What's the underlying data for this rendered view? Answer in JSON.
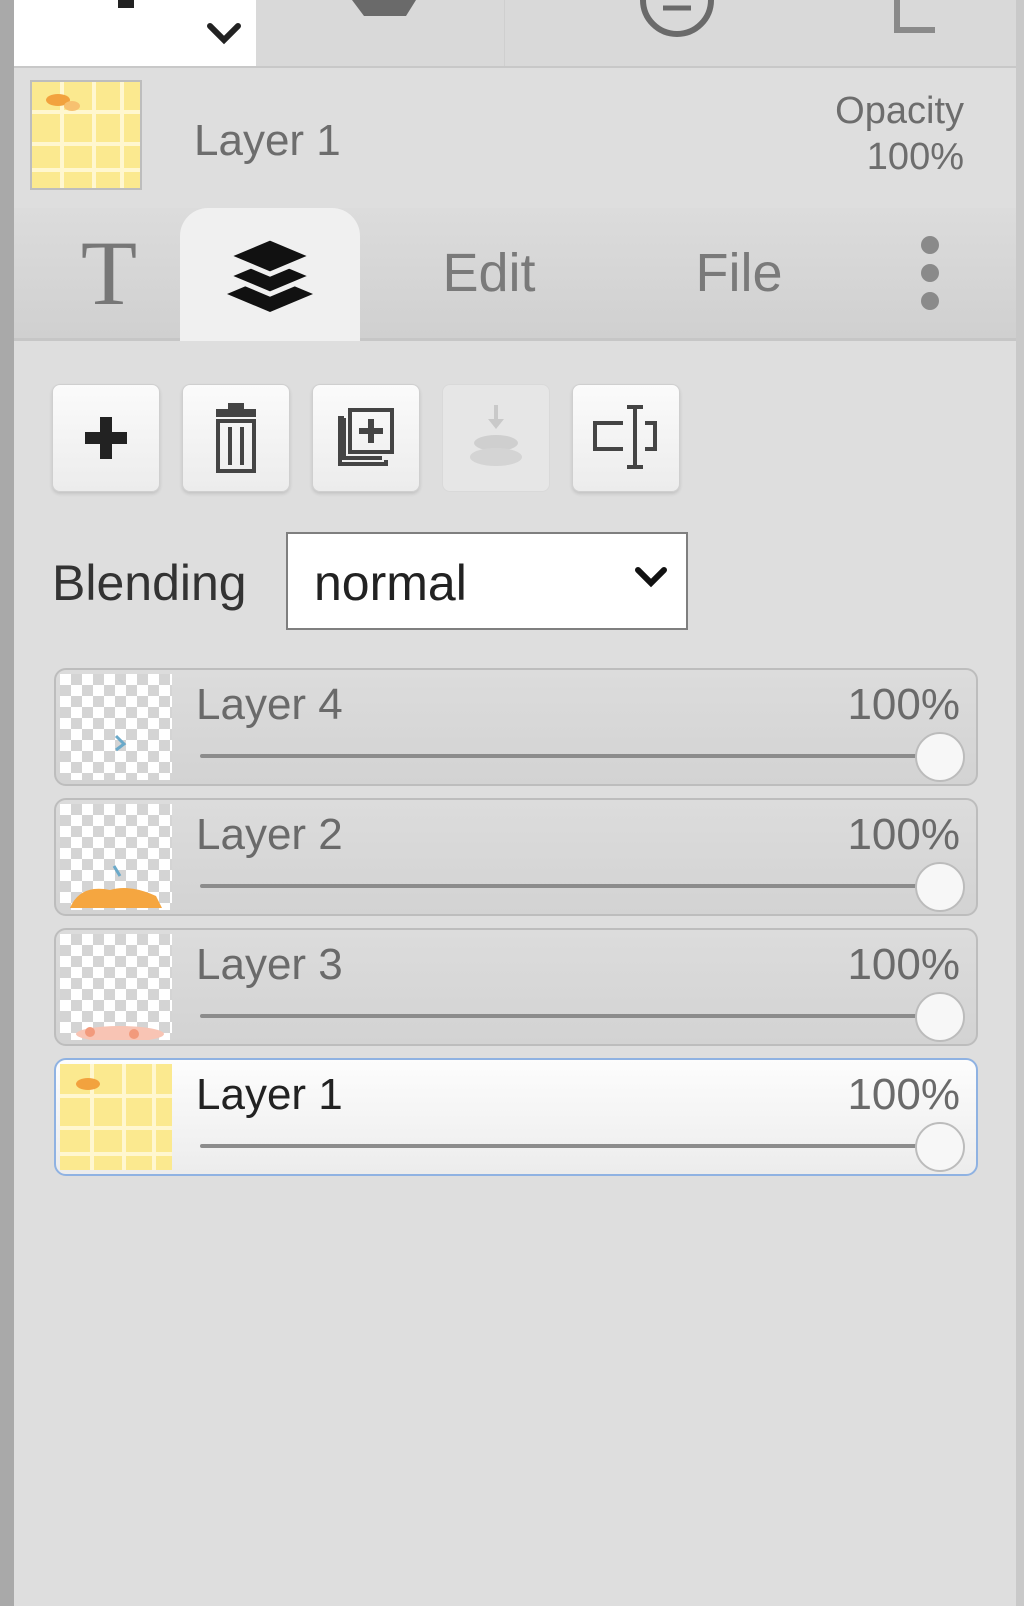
{
  "header": {
    "layer_name": "Layer 1",
    "opacity_label": "Opacity",
    "opacity_value": "100%"
  },
  "tabs": [
    {
      "id": "text",
      "label": "T",
      "icon": "text-icon"
    },
    {
      "id": "layers",
      "label": "",
      "icon": "layers-icon"
    },
    {
      "id": "edit",
      "label": "Edit"
    },
    {
      "id": "file",
      "label": "File"
    },
    {
      "id": "more",
      "label": "",
      "icon": "more-vertical-icon"
    }
  ],
  "actions": [
    {
      "name": "add-layer",
      "icon": "plus-icon"
    },
    {
      "name": "delete-layer",
      "icon": "trash-icon"
    },
    {
      "name": "duplicate-layer",
      "icon": "duplicate-icon"
    },
    {
      "name": "merge-down",
      "icon": "merge-down-icon",
      "disabled": true
    },
    {
      "name": "rename-layer",
      "icon": "rename-icon"
    }
  ],
  "blending": {
    "label": "Blending",
    "value": "normal"
  },
  "layers": [
    {
      "name": "Layer 4",
      "opacity": "100%",
      "level": 1.0,
      "selected": false
    },
    {
      "name": "Layer 2",
      "opacity": "100%",
      "level": 1.0,
      "selected": false
    },
    {
      "name": "Layer 3",
      "opacity": "100%",
      "level": 1.0,
      "selected": false
    },
    {
      "name": "Layer 1",
      "opacity": "100%",
      "level": 1.0,
      "selected": true
    }
  ],
  "colors": {
    "selection_border": "#8fb2e2",
    "panel_bg": "#dedede",
    "thumb_yellow": "#fbe98f",
    "thumb_orange": "#f5a640"
  }
}
